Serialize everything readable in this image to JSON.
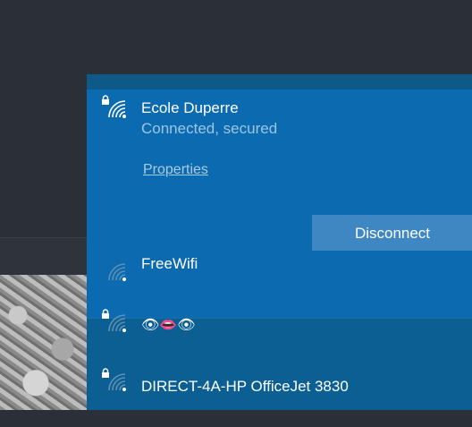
{
  "connected_network": {
    "name": "Ecole Duperre",
    "status": "Connected, secured",
    "properties_label": "Properties",
    "disconnect_label": "Disconnect",
    "secured": true,
    "icon": "wifi-icon"
  },
  "networks": [
    {
      "name": "FreeWifi",
      "secured": false,
      "icon": "wifi-icon"
    },
    {
      "name": "👁👄👁",
      "secured": true,
      "icon": "wifi-icon"
    },
    {
      "name": "DIRECT-4A-HP OfficeJet 3830",
      "secured": true,
      "icon": "wifi-icon"
    }
  ],
  "colors": {
    "flyout_bg": "#0b5f93",
    "connected_bg": "#0b6ab0",
    "button_bg": "#3e87c3",
    "status_text": "#9bc6e6"
  }
}
